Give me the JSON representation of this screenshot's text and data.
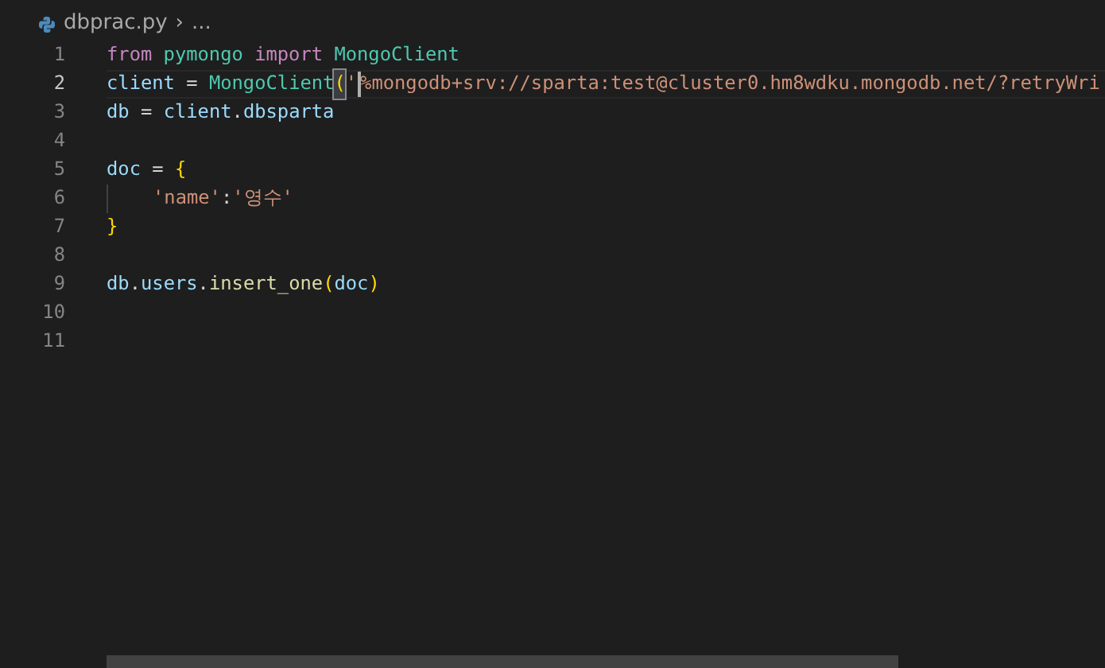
{
  "breadcrumb": {
    "file": "dbprac.py",
    "separator": "›",
    "more": "..."
  },
  "lines": [
    {
      "number": "1",
      "active": false,
      "tokens": [
        {
          "kind": "keyword",
          "text": "from "
        },
        {
          "kind": "type",
          "text": "pymongo "
        },
        {
          "kind": "keyword",
          "text": "import "
        },
        {
          "kind": "type",
          "text": "MongoClient"
        }
      ]
    },
    {
      "number": "2",
      "active": true,
      "tokens": [
        {
          "kind": "variable",
          "text": "client "
        },
        {
          "kind": "plain",
          "text": "= "
        },
        {
          "kind": "type",
          "text": "MongoClient"
        },
        {
          "kind": "bracket",
          "text": "(",
          "matched": true
        },
        {
          "kind": "string",
          "text": "'"
        },
        {
          "kind": "cursor"
        },
        {
          "kind": "string",
          "text": "%mongodb+srv://sparta:test@cluster0.hm8wdku.mongodb.net/?retryWri"
        }
      ]
    },
    {
      "number": "3",
      "active": false,
      "tokens": [
        {
          "kind": "variable",
          "text": "db "
        },
        {
          "kind": "plain",
          "text": "= "
        },
        {
          "kind": "variable",
          "text": "client"
        },
        {
          "kind": "plain",
          "text": "."
        },
        {
          "kind": "variable",
          "text": "dbsparta"
        }
      ]
    },
    {
      "number": "4",
      "active": false
    },
    {
      "number": "5",
      "active": false,
      "tokens": [
        {
          "kind": "variable",
          "text": "doc "
        },
        {
          "kind": "plain",
          "text": "= "
        },
        {
          "kind": "bracket",
          "text": "{",
          "matched": false
        }
      ]
    },
    {
      "number": "6",
      "active": false,
      "indent_guide": true,
      "tokens": [
        {
          "kind": "string",
          "text": "'name'"
        },
        {
          "kind": "plain",
          "text": ":"
        },
        {
          "kind": "string",
          "text": "'영수'"
        }
      ]
    },
    {
      "number": "7",
      "active": false,
      "tokens": [
        {
          "kind": "bracket",
          "text": "}",
          "matched": false
        }
      ]
    },
    {
      "number": "8",
      "active": false
    },
    {
      "number": "9",
      "active": false,
      "tokens": [
        {
          "kind": "variable",
          "text": "db"
        },
        {
          "kind": "plain",
          "text": "."
        },
        {
          "kind": "variable",
          "text": "users"
        },
        {
          "kind": "plain",
          "text": "."
        },
        {
          "kind": "function",
          "text": "insert_one"
        },
        {
          "kind": "bracket",
          "text": "(",
          "matched": false
        },
        {
          "kind": "variable",
          "text": "doc"
        },
        {
          "kind": "bracket",
          "text": ")",
          "matched": false
        }
      ]
    },
    {
      "number": "10",
      "active": false
    },
    {
      "number": "11",
      "active": false
    }
  ]
}
